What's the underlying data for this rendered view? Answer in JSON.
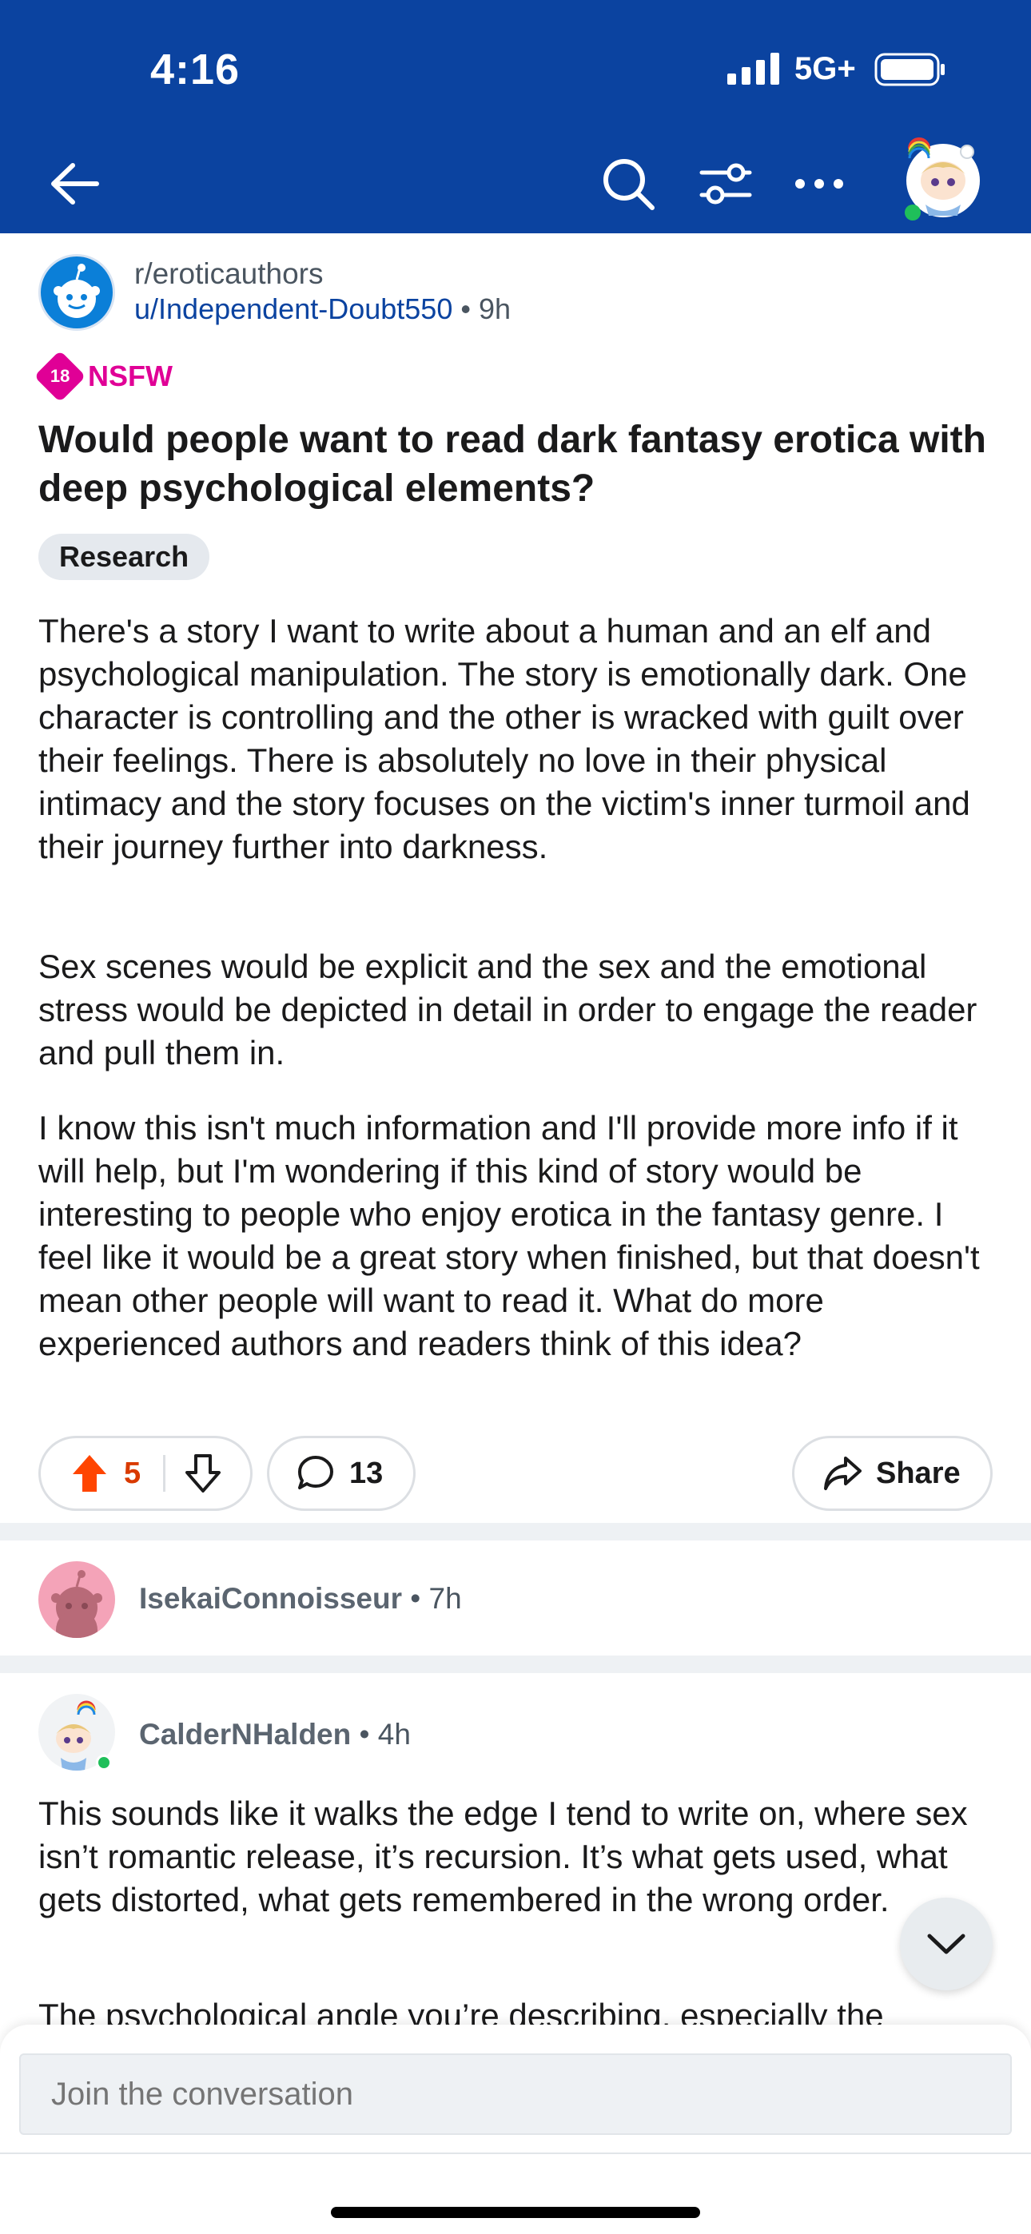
{
  "status_bar": {
    "time": "4:16",
    "network": "5G+"
  },
  "header": {
    "back_icon": "arrow-left-icon",
    "search_icon": "search-icon",
    "filter_icon": "sliders-icon",
    "more_icon": "more-horizontal-icon",
    "avatar_icon": "user-avatar-icon",
    "color": "#0b43a0"
  },
  "post": {
    "subreddit": "r/eroticauthors",
    "author": "u/Independent-Doubt550",
    "separator": "•",
    "age": "9h",
    "nsfw_badge": "18",
    "nsfw_label": "NSFW",
    "title": "Would people want to read dark fantasy erotica with deep psychological elements?",
    "flair": "Research",
    "paragraphs": [
      "There's a story I want to write about a human and an elf and psychological manipulation. The story is emotionally dark. One character is controlling and the other is wracked with guilt over their feelings. There is absolutely no love in their physical intimacy and the story focuses on the victim's inner turmoil and their journey further into darkness.",
      "Sex scenes would be explicit and the sex and the emotional stress would be depicted in detail in order to engage the reader and pull them in.",
      "I know this isn't much information and I'll provide more info if it will help, but I'm wondering if this kind of story would be interesting to people who enjoy erotica in the fantasy genre. I feel like it would be a great story when finished, but that doesn't mean other people will want to read it. What do more experienced authors and readers think of this idea?"
    ],
    "upvotes": "5",
    "comments": "13",
    "share_label": "Share",
    "upvote_color": "#ff4500"
  },
  "comments": [
    {
      "username": "IsekaiConnoisseur",
      "separator": "•",
      "age": "7h"
    },
    {
      "username": "CalderNHalden",
      "separator": "•",
      "age": "4h",
      "text": "This sounds like it walks the edge I tend to write on, where sex isn’t romantic release, it’s recursion. It’s what gets used, what gets distorted, what gets remembered in the wrong order.",
      "text2": "The psychological angle you’re describing, especially the"
    }
  ],
  "compose": {
    "placeholder": "Join the conversation"
  }
}
